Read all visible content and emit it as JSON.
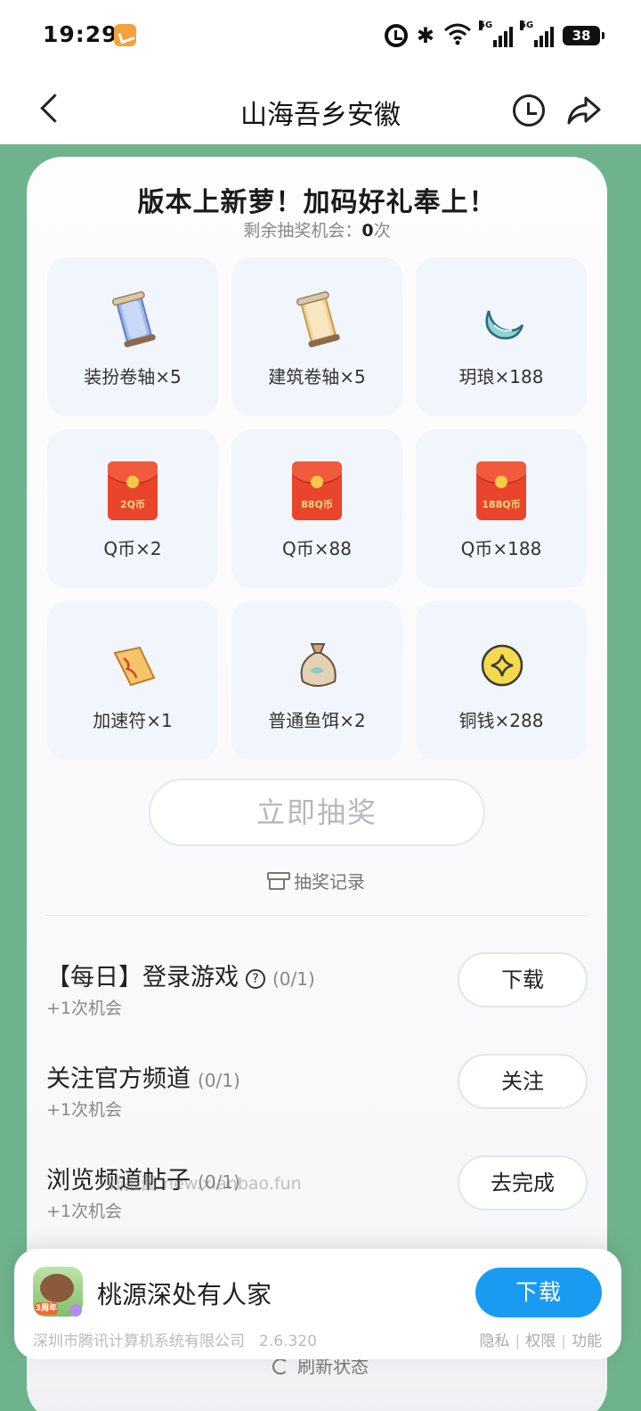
{
  "status": {
    "time": "19:29",
    "battery": "38",
    "net1": "5G",
    "net2": "5G"
  },
  "header": {
    "title": "山海吾乡安徽"
  },
  "card": {
    "title": "版本上新萝！加码好礼奉上！",
    "chances_label": "剩余抽奖机会：",
    "chances_value": "0",
    "chances_unit": "次"
  },
  "prizes": [
    {
      "label": "装扮卷轴×5",
      "icon": "blue-scroll-icon"
    },
    {
      "label": "建筑卷轴×5",
      "icon": "yellow-scroll-icon"
    },
    {
      "label": "玥琅×188",
      "icon": "moon-gem-icon"
    },
    {
      "label": "Q币×2",
      "icon": "red-packet-icon",
      "amount": "2Q币"
    },
    {
      "label": "Q币×88",
      "icon": "red-packet-icon",
      "amount": "88Q币"
    },
    {
      "label": "Q币×188",
      "icon": "red-packet-icon",
      "amount": "188Q币"
    },
    {
      "label": "加速符×1",
      "icon": "talisman-icon"
    },
    {
      "label": "普通鱼饵×2",
      "icon": "bait-bag-icon"
    },
    {
      "label": "铜钱×288",
      "icon": "coin-icon"
    }
  ],
  "draw_button": "立即抽奖",
  "record_link": "抽奖记录",
  "tasks": [
    {
      "title": "【每日】登录游戏",
      "progress": "(0/1)",
      "reward": "+1次机会",
      "button": "下载"
    },
    {
      "title": "关注官方频道",
      "progress": "(0/1)",
      "reward": "+1次机会",
      "button": "关注"
    },
    {
      "title": "浏览频道帖子",
      "progress": "(0/1)",
      "reward": "+1次机会",
      "button": "去完成"
    }
  ],
  "watermark": "线报酱  new.xianbao.fun",
  "refresh": "刷新状态",
  "banner": {
    "game_name": "桃源深处有人家",
    "icon_tag": "3周年",
    "download": "下载",
    "company": "深圳市腾讯计算机系统有限公司",
    "version": "2.6.320",
    "links": [
      "隐私",
      "权限",
      "功能"
    ]
  },
  "colors": {
    "background": "#6fb38c",
    "accent": "#1a9bf2",
    "card": "#f1f5fc"
  }
}
